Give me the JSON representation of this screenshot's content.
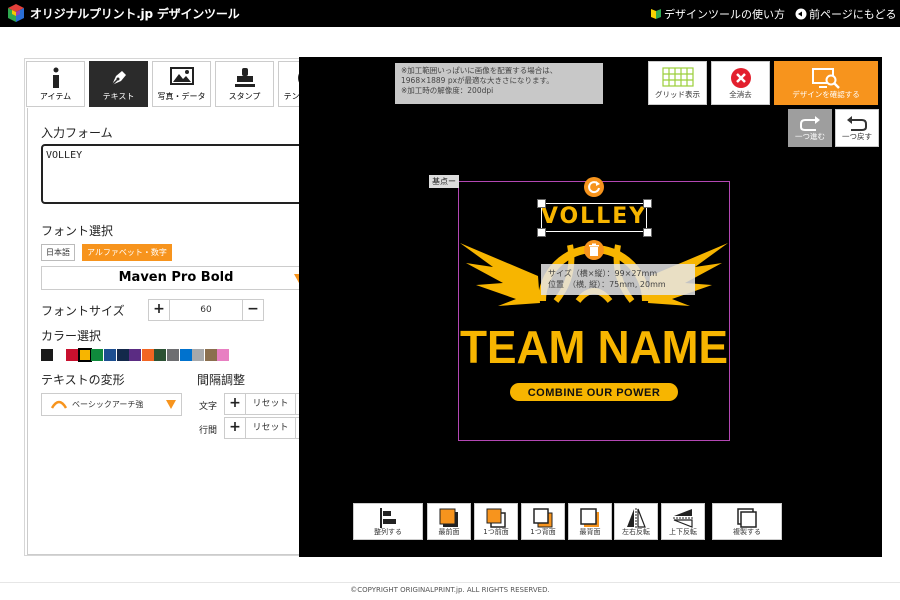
{
  "header": {
    "logo_text": "オリジナルプリント.jp デザインツール",
    "howto_label": "デザインツールの使い方",
    "back_label": "前ページにもどる"
  },
  "tabs": [
    {
      "label": "アイテム",
      "icon": "info-icon"
    },
    {
      "label": "テキスト",
      "icon": "pen-icon"
    },
    {
      "label": "写真・データ",
      "icon": "image-icon"
    },
    {
      "label": "スタンプ",
      "icon": "stamp-icon"
    },
    {
      "label": "テンプレート",
      "icon": "template-icon"
    }
  ],
  "active_tab": "テキスト",
  "input_form": {
    "title": "入力フォーム",
    "value": "VOLLEY"
  },
  "font": {
    "title": "フォント選択",
    "tab_jp": "日本語",
    "tab_alpha": "アルファベット・数字",
    "selected": "Maven Pro Bold"
  },
  "font_size": {
    "title": "フォントサイズ",
    "value": "60"
  },
  "color": {
    "title": "カラー選択",
    "swatches": [
      "#1a1a1a",
      "#ffffff",
      "#c8102e",
      "#f7b500",
      "#0f8a3c",
      "#1d4f91",
      "#13294b",
      "#5b2c83",
      "#f26522",
      "#2c5234",
      "#6d6e71",
      "#0072ce",
      "#a7a8aa",
      "#8b6f4e",
      "#e87fc2"
    ],
    "selected_index": 3
  },
  "transform": {
    "title": "テキストの変形",
    "selected": "ベーシックアーチ強"
  },
  "spacing": {
    "title": "間隔調整",
    "char_label": "文字",
    "line_label": "行間",
    "reset_label": "リセット"
  },
  "notice": {
    "lines": [
      "※加工範囲いっぱいに画像を配置する場合は、",
      "1968×1889 pxが最適な大きさになります。",
      "※加工時の解像度：200dpi"
    ]
  },
  "toolbar": {
    "grid_label": "グリッド表示",
    "clear_label": "全消去",
    "confirm_label": "デザインを確認する",
    "redo_label": "一つ進む",
    "undo_label": "一つ戻す"
  },
  "canvas": {
    "origin_label": "基点ー",
    "design": {
      "arch_text": "VOLLEY",
      "main_text": "TEAM NAME",
      "tagline": "COMBINE OUR POWER",
      "accent": "#f7b500"
    },
    "info": {
      "size_line": "サイズ（横×縦）：99×27mm",
      "pos_line": "位置　（横, 縦）：75mm, 20mm"
    }
  },
  "bottom_tools": [
    {
      "label": "整列する",
      "icon": "align-icon"
    },
    {
      "label": "最前面",
      "icon": "bring-front-icon"
    },
    {
      "label": "1つ前面",
      "icon": "forward-icon"
    },
    {
      "label": "1つ背面",
      "icon": "backward-icon"
    },
    {
      "label": "最背面",
      "icon": "send-back-icon"
    },
    {
      "label": "左右反転",
      "icon": "flip-h-icon"
    },
    {
      "label": "上下反転",
      "icon": "flip-v-icon"
    },
    {
      "label": "複製する",
      "icon": "duplicate-icon"
    }
  ],
  "footer": {
    "copyright": "©COPYRIGHT ORIGINALPRINT.jp. ALL RIGHTS RESERVED."
  }
}
